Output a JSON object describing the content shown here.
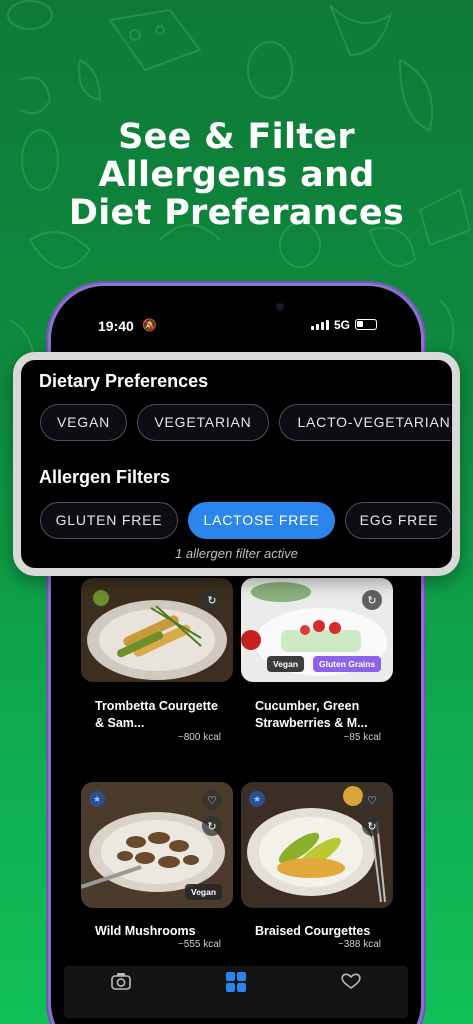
{
  "headline": [
    "See & Filter",
    "Allergens and",
    "Diet Preferances"
  ],
  "status_bar": {
    "time": "19:40",
    "network": "5G"
  },
  "dietary_preferences": {
    "title": "Dietary Preferences",
    "chips": [
      "VEGAN",
      "VEGETARIAN",
      "LACTO-VEGETARIAN"
    ]
  },
  "allergen_filters": {
    "title": "Allergen Filters",
    "chips": [
      "GLUTEN FREE",
      "LACTOSE FREE",
      "EGG FREE"
    ],
    "active": "LACTOSE FREE",
    "status": "1 allergen filter active"
  },
  "recipes": [
    {
      "title": "Trombetta Courgette & Sam...",
      "kcal": "~800 kcal",
      "tags": []
    },
    {
      "title": "Cucumber, Green Strawberries & M...",
      "kcal": "~85 kcal",
      "tags": [
        "Vegan",
        "Gluten Grains"
      ]
    },
    {
      "title": "Wild Mushrooms",
      "kcal": "~555 kcal",
      "tags": [
        "Vegan"
      ]
    },
    {
      "title": "Braised Courgettes",
      "kcal": "~388 kcal",
      "tags": []
    }
  ],
  "tabs": [
    {
      "icon": "camera-icon"
    },
    {
      "icon": "grid-icon",
      "active": true
    },
    {
      "icon": "heart-icon"
    }
  ],
  "colors": {
    "background": "#0e8a3e",
    "accent": "#2a86ec",
    "tag_purple": "#8c63e8",
    "phone_frame": "#8a74c9"
  }
}
